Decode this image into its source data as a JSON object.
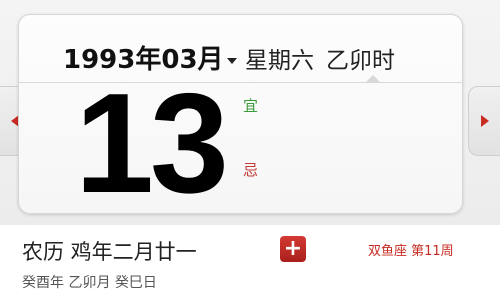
{
  "header": {
    "year_month": "1993年03月",
    "weekday": "星期六",
    "hour_ganzhi": "乙卯时"
  },
  "day": "13",
  "yi_label": "宜",
  "ji_label": "忌",
  "lunar_date": "农历 鸡年二月廿一",
  "add_button": "+",
  "constellation": "双鱼座 第11周",
  "ganzhi_date": "癸酉年 乙卯月 癸巳日",
  "colors": {
    "accent_red": "#c72b22",
    "yi_green": "#3a9b3a"
  },
  "icons": {
    "prev": "triangle-left",
    "next": "triangle-right",
    "month_dropdown": "caret-down",
    "add": "plus"
  }
}
